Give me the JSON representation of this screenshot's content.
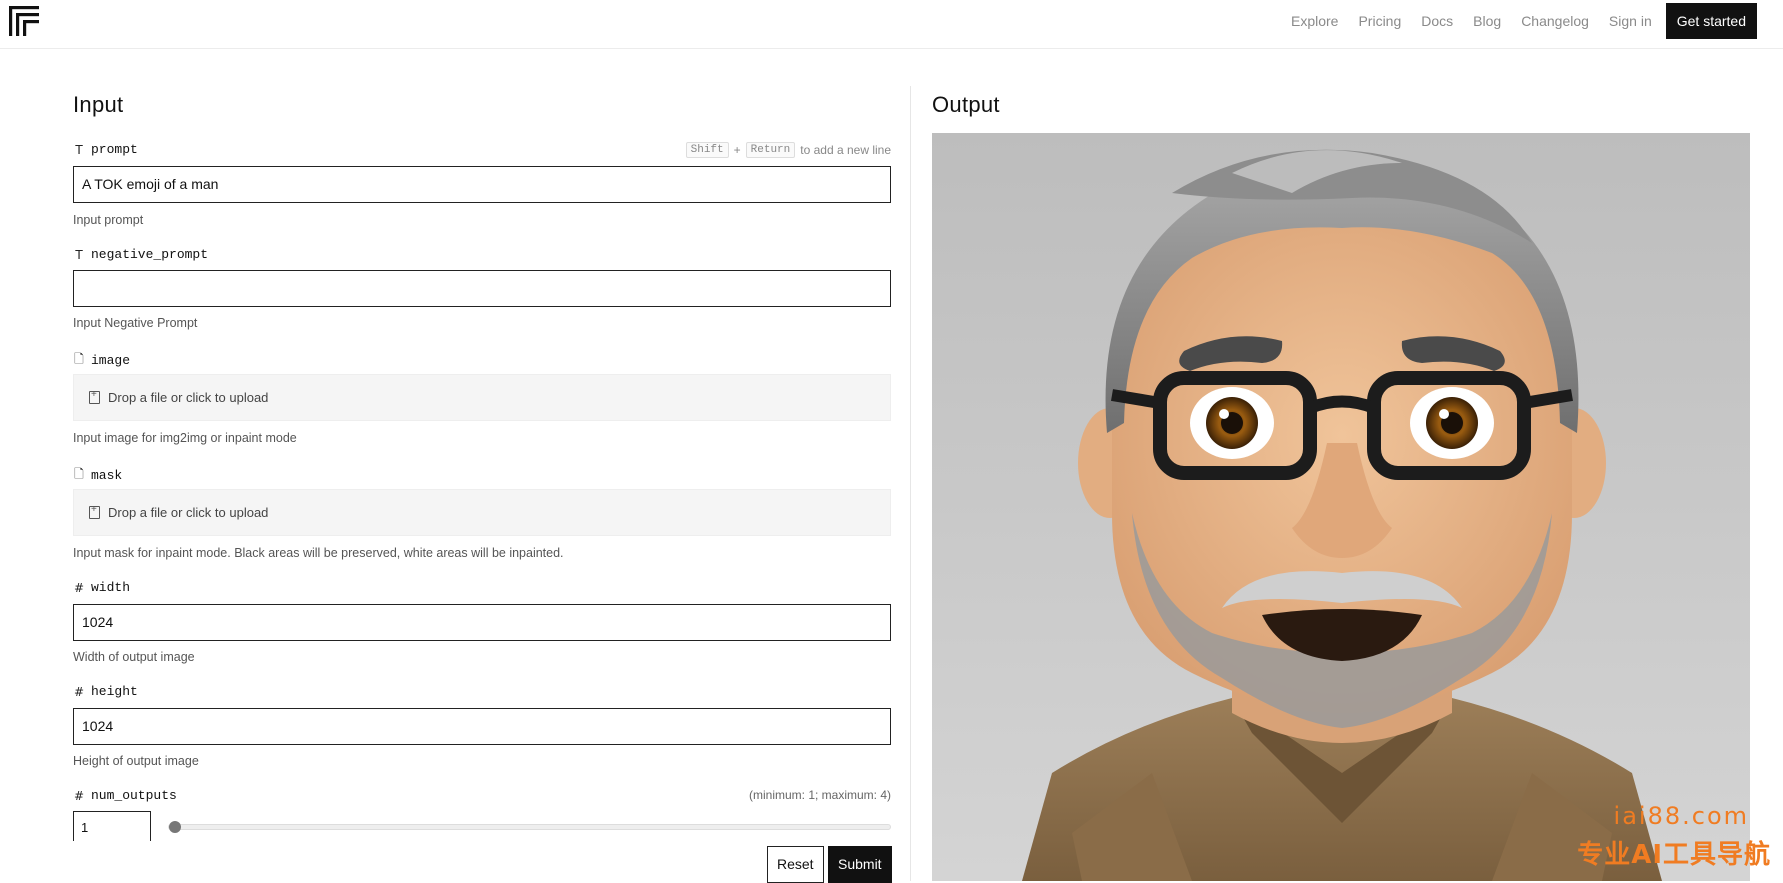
{
  "nav": {
    "logo_icon": "replicate-logo-icon",
    "links": [
      "Explore",
      "Pricing",
      "Docs",
      "Blog",
      "Changelog",
      "Sign in"
    ],
    "cta": "Get started"
  },
  "input": {
    "title": "Input",
    "prompt": {
      "label": "prompt",
      "type_icon": "text-type-icon",
      "hint_key1": "Shift",
      "hint_plus": "+",
      "hint_key2": "Return",
      "hint_text": "to add a new line",
      "value": "A TOK emoji of a man",
      "description": "Input prompt"
    },
    "negative_prompt": {
      "label": "negative_prompt",
      "type_icon": "text-type-icon",
      "value": "",
      "description": "Input Negative Prompt"
    },
    "image": {
      "label": "image",
      "type_icon": "file-icon",
      "upload_text": "Drop a file or click to upload",
      "description": "Input image for img2img or inpaint mode"
    },
    "mask": {
      "label": "mask",
      "type_icon": "file-icon",
      "upload_text": "Drop a file or click to upload",
      "description": "Input mask for inpaint mode. Black areas will be preserved, white areas will be inpainted."
    },
    "width": {
      "label": "width",
      "type_icon": "number-type-icon",
      "value": "1024",
      "description": "Width of output image"
    },
    "height": {
      "label": "height",
      "type_icon": "number-type-icon",
      "value": "1024",
      "description": "Height of output image"
    },
    "num_outputs": {
      "label": "num_outputs",
      "type_icon": "number-type-icon",
      "range_hint": "(minimum: 1; maximum: 4)",
      "value": "1",
      "slider_fraction": 0
    },
    "reset_label": "Reset",
    "submit_label": "Submit"
  },
  "output": {
    "title": "Output",
    "image_subject": "emoji-style portrait of a man with gray hair, glasses and gray beard"
  },
  "watermark": {
    "line1": "iai88.com",
    "line2": "专业AI工具导航"
  },
  "colors": {
    "accent": "#111111",
    "watermark": "#f07c22",
    "output_bg": "#c4c4c4"
  }
}
